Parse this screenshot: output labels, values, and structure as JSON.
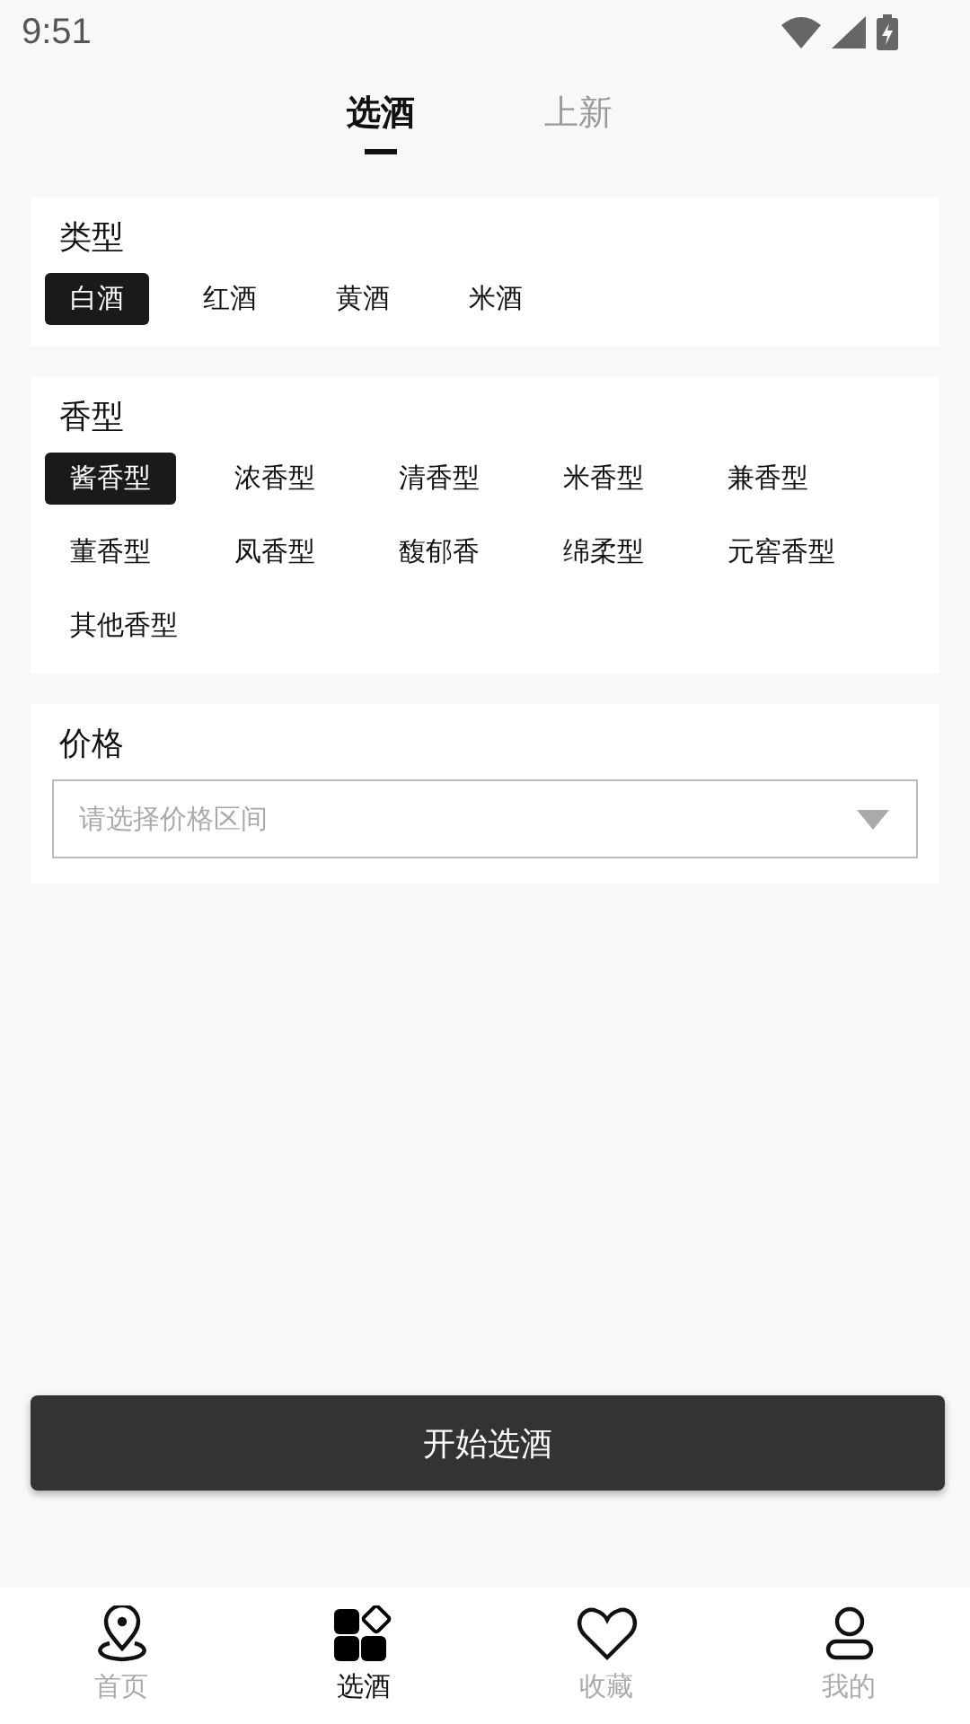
{
  "status_bar": {
    "time": "9:51"
  },
  "top_tabs": [
    {
      "label": "选酒",
      "selected": true
    },
    {
      "label": "上新",
      "selected": false
    }
  ],
  "type_section": {
    "title": "类型",
    "options": [
      {
        "label": "白酒",
        "selected": true
      },
      {
        "label": "红酒",
        "selected": false
      },
      {
        "label": "黄酒",
        "selected": false
      },
      {
        "label": "米酒",
        "selected": false
      }
    ]
  },
  "aroma_section": {
    "title": "香型",
    "options": [
      {
        "label": "酱香型",
        "selected": true
      },
      {
        "label": "浓香型",
        "selected": false
      },
      {
        "label": "清香型",
        "selected": false
      },
      {
        "label": "米香型",
        "selected": false
      },
      {
        "label": "兼香型",
        "selected": false
      },
      {
        "label": "董香型",
        "selected": false
      },
      {
        "label": "凤香型",
        "selected": false
      },
      {
        "label": "馥郁香",
        "selected": false
      },
      {
        "label": "绵柔型",
        "selected": false
      },
      {
        "label": "元窖香型",
        "selected": false
      },
      {
        "label": "其他香型",
        "selected": false
      }
    ]
  },
  "price_section": {
    "title": "价格",
    "placeholder": "请选择价格区间"
  },
  "start_button": "开始选酒",
  "bottom_nav": [
    {
      "kind": "pin",
      "label": "首页",
      "selected": false
    },
    {
      "kind": "blocks",
      "label": "选酒",
      "selected": true
    },
    {
      "kind": "heart",
      "label": "收藏",
      "selected": false
    },
    {
      "kind": "person",
      "label": "我的",
      "selected": false
    }
  ]
}
